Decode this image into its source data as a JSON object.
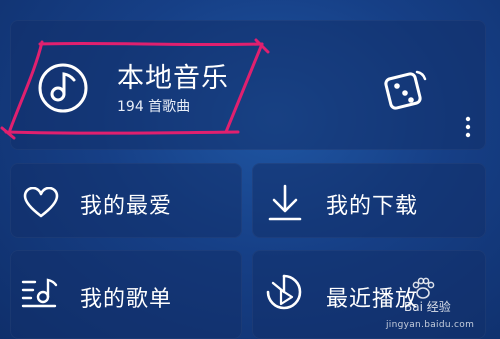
{
  "local_music": {
    "title": "本地音乐",
    "count_text": "194 首歌曲"
  },
  "tiles": {
    "favorites": "我的最爱",
    "downloads": "我的下载",
    "playlists": "我的歌单",
    "recent": "最近播放"
  },
  "watermark": {
    "brand": "Bai 经验",
    "url": "jingyan.baidu.com"
  },
  "colors": {
    "annotation": "#e0206f",
    "background": "#163f86",
    "text": "#ffffff"
  },
  "icons": [
    "music-note-icon",
    "dice-icon",
    "more-vertical-icon",
    "heart-icon",
    "download-icon",
    "playlist-icon",
    "recent-play-icon",
    "paw-icon"
  ]
}
